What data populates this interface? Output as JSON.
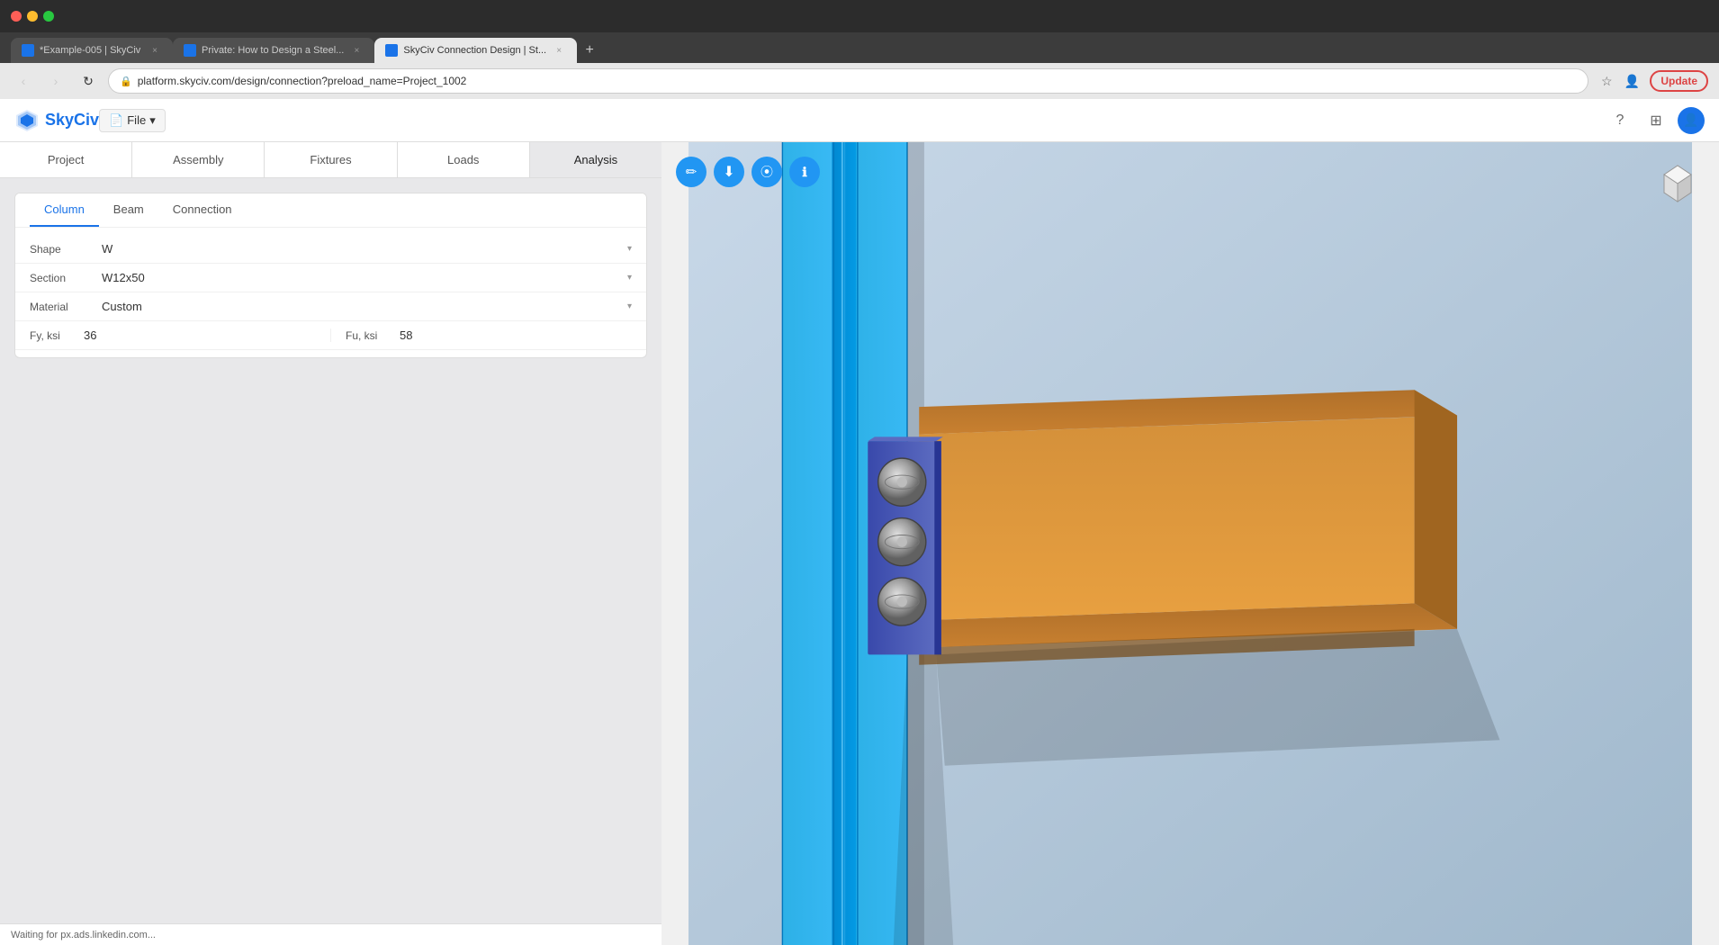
{
  "browser": {
    "tabs": [
      {
        "id": "tab1",
        "title": "*Example-005 | SkyCiv",
        "active": false,
        "favicon_color": "#1a73e8"
      },
      {
        "id": "tab2",
        "title": "Private: How to Design a Steel...",
        "active": false,
        "favicon_color": "#1a73e8"
      },
      {
        "id": "tab3",
        "title": "SkyCiv Connection Design | St...",
        "active": true,
        "favicon_color": "#1a73e8"
      }
    ],
    "url": "platform.skyciv.com/design/connection?preload_name=Project_1002",
    "update_label": "Update"
  },
  "app": {
    "logo_text": "SkyCiv",
    "file_btn_label": "File",
    "header_icons": [
      "question-icon",
      "grid-icon",
      "avatar-icon"
    ]
  },
  "nav_tabs": [
    {
      "id": "project",
      "label": "Project",
      "active": false
    },
    {
      "id": "assembly",
      "label": "Assembly",
      "active": false
    },
    {
      "id": "fixtures",
      "label": "Fixtures",
      "active": false
    },
    {
      "id": "loads",
      "label": "Loads",
      "active": false
    },
    {
      "id": "analysis",
      "label": "Analysis",
      "active": true
    }
  ],
  "sub_tabs": [
    {
      "id": "column",
      "label": "Column",
      "active": true
    },
    {
      "id": "beam",
      "label": "Beam",
      "active": false
    },
    {
      "id": "connection",
      "label": "Connection",
      "active": false
    }
  ],
  "form": {
    "shape": {
      "label": "Shape",
      "value": "W"
    },
    "section": {
      "label": "Section",
      "value": "W12x50"
    },
    "material": {
      "label": "Material",
      "value": "Custom"
    },
    "fy_label": "Fy, ksi",
    "fy_value": "36",
    "fu_label": "Fu, ksi",
    "fu_value": "58"
  },
  "view_tools": [
    {
      "id": "pencil-icon",
      "unicode": "✏",
      "style": "blue"
    },
    {
      "id": "download-icon",
      "unicode": "↓",
      "style": "blue"
    },
    {
      "id": "camera-icon",
      "unicode": "●",
      "style": "blue"
    },
    {
      "id": "info-icon",
      "unicode": "ℹ",
      "style": "blue"
    }
  ],
  "status_bar": {
    "text": "Waiting for px.ads.linkedin.com..."
  },
  "colors": {
    "column_blue": "#29B6F6",
    "beam_orange": "#E8973A",
    "plate_blue": "#3F51B5",
    "bolt_gray": "#9E9E9E",
    "background": "#b0c4d8"
  }
}
